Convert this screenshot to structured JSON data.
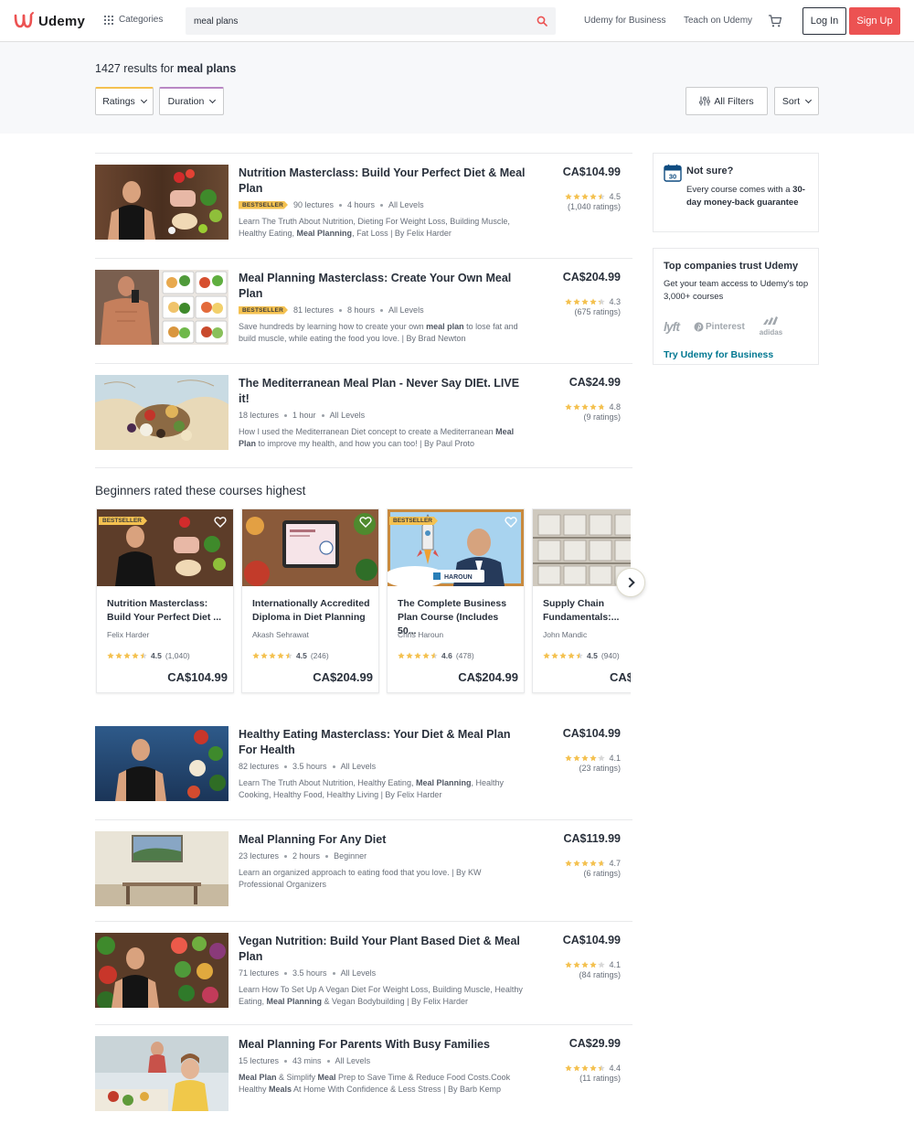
{
  "header": {
    "brand": "Udemy",
    "categories_label": "Categories",
    "search_value": "meal plans",
    "business_link": "Udemy for Business",
    "teach_link": "Teach on Udemy",
    "login_label": "Log In",
    "signup_label": "Sign Up",
    "accent_color": "#ec5252"
  },
  "results": {
    "count": "1427 results for",
    "query": "meal plans",
    "filters": {
      "ratings": "Ratings",
      "duration": "Duration",
      "all_filters": "All Filters",
      "sort": "Sort"
    }
  },
  "courses_top": [
    {
      "title": "Nutrition Masterclass: Build Your Perfect Diet & Meal Plan",
      "badge": "BESTSELLER",
      "lectures": "90 lectures",
      "hours": "4 hours",
      "level": "All Levels",
      "desc_parts": [
        "Learn The Truth About Nutrition, Dieting For Weight Loss, Building Muscle, Healthy Eating, ",
        "Meal Planning",
        ", Fat Loss | By Felix Harder"
      ],
      "price": "CA$104.99",
      "rating": "4.5",
      "rating_count": "(1,040 ratings)",
      "stars": 4.5
    },
    {
      "title": "Meal Planning Masterclass: Create Your Own Meal Plan",
      "badge": "BESTSELLER",
      "lectures": "81 lectures",
      "hours": "8 hours",
      "level": "All Levels",
      "desc_parts": [
        "Save hundreds by learning how to create your own ",
        "meal plan",
        " to lose fat and build muscle, while eating the food you love. | By Brad Newton"
      ],
      "price": "CA$204.99",
      "rating": "4.3",
      "rating_count": "(675 ratings)",
      "stars": 4.3
    },
    {
      "title": "The Mediterranean Meal Plan - Never Say DIEt. LIVE it!",
      "badge": "",
      "lectures": "18 lectures",
      "hours": "1 hour",
      "level": "All Levels",
      "desc_parts": [
        "How I used the Mediterranean Diet concept to create a Mediterranean ",
        "Meal Plan",
        " to improve my health, and how you can too! | By Paul Proto"
      ],
      "price": "CA$24.99",
      "rating": "4.8",
      "rating_count": "(9 ratings)",
      "stars": 4.8
    }
  ],
  "carousel": {
    "title": "Beginners rated these courses highest",
    "cards": [
      {
        "badge": "BESTSELLER",
        "title": "Nutrition Masterclass: Build Your Perfect Diet ...",
        "author": "Felix Harder",
        "rating": "4.5",
        "count": "(1,040)",
        "price": "CA$104.99",
        "stars": 4.5
      },
      {
        "badge": "",
        "title": "Internationally Accredited Diploma in Diet Planning",
        "author": "Akash Sehrawat",
        "rating": "4.5",
        "count": "(246)",
        "price": "CA$204.99",
        "stars": 4.5
      },
      {
        "badge": "BESTSELLER",
        "title": "The Complete Business Plan Course (Includes 50...",
        "author": "Chris Haroun",
        "rating": "4.6",
        "count": "(478)",
        "price": "CA$204.99",
        "stars": 4.6
      },
      {
        "badge": "",
        "title": "Supply Chain Fundamentals:...",
        "author": "John Mandic",
        "rating": "4.5",
        "count": "(940)",
        "price": "CA$",
        "stars": 4.5
      }
    ]
  },
  "courses_bottom": [
    {
      "title": "Healthy Eating Masterclass: Your Diet & Meal Plan For Health",
      "badge": "",
      "lectures": "82 lectures",
      "hours": "3.5 hours",
      "level": "All Levels",
      "desc_parts": [
        "Learn The Truth About Nutrition, Healthy Eating, ",
        "Meal Planning",
        ", Healthy Cooking, Healthy Food, Healthy Living | By Felix Harder"
      ],
      "price": "CA$104.99",
      "rating": "4.1",
      "rating_count": "(23 ratings)",
      "stars": 4.1
    },
    {
      "title": "Meal Planning For Any Diet",
      "badge": "",
      "lectures": "23 lectures",
      "hours": "2 hours",
      "level": "Beginner",
      "desc_parts": [
        "Learn an organized approach to eating food that you love. | By KW Professional Organizers",
        "",
        ""
      ],
      "price": "CA$119.99",
      "rating": "4.7",
      "rating_count": "(6 ratings)",
      "stars": 4.7
    },
    {
      "title": "Vegan Nutrition: Build Your Plant Based Diet & Meal Plan",
      "badge": "",
      "lectures": "71 lectures",
      "hours": "3.5 hours",
      "level": "All Levels",
      "desc_parts": [
        "Learn How To Set Up A Vegan Diet For Weight Loss, Building Muscle, Healthy Eating, ",
        "Meal Planning",
        " & Vegan Bodybuilding | By Felix Harder"
      ],
      "price": "CA$104.99",
      "rating": "4.1",
      "rating_count": "(84 ratings)",
      "stars": 4.1
    },
    {
      "title": "Meal Planning For Parents With Busy Families",
      "badge": "",
      "lectures": "15 lectures",
      "hours": "43 mins",
      "level": "All Levels",
      "desc_parts": [
        "",
        "Meal Plan",
        " & Simplify "
      ],
      "desc_extra": [
        "Meal",
        " Prep to Save Time & Reduce Food Costs.Cook Healthy ",
        "Meals",
        " At Home With Confidence & Less Stress | By Barb Kemp"
      ],
      "price": "CA$29.99",
      "rating": "4.4",
      "rating_count": "(11 ratings)",
      "stars": 4.4
    }
  ],
  "sidebar": {
    "guarantee": {
      "title": "Not sure?",
      "text": "Every course comes with a",
      "bold": "30-day money-back guarantee",
      "calendar_day": "30"
    },
    "business": {
      "title": "Top companies trust Udemy",
      "text": "Get your team access to Udemy's top 3,000+ courses",
      "logos": [
        "lyft",
        "Pinterest",
        "adidas"
      ],
      "link": "Try Udemy for Business"
    }
  },
  "colors": {
    "star": "#f4c150",
    "badge": "#f4c150",
    "link": "#007791"
  }
}
